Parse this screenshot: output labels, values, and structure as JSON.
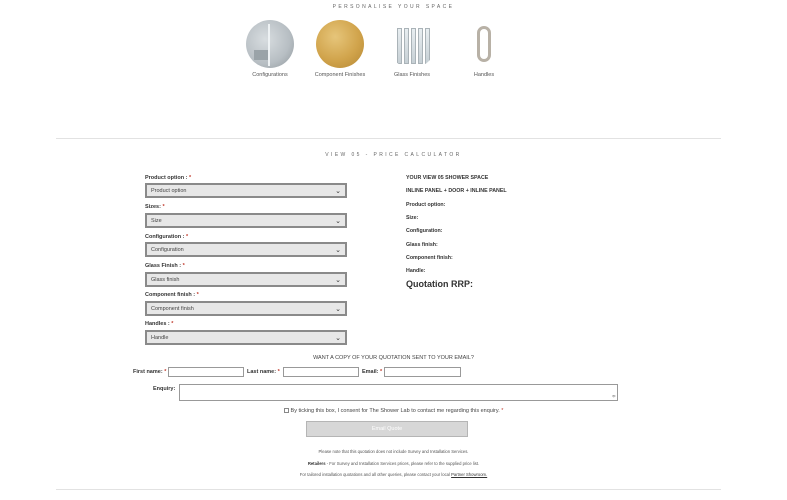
{
  "personalise": {
    "title": "PERSONALISE YOUR SPACE",
    "options": [
      {
        "label": "Configurations"
      },
      {
        "label": "Component Finishes"
      },
      {
        "label": "Glass Finishes"
      },
      {
        "label": "Handles"
      }
    ]
  },
  "calculator": {
    "title": "VIEW 05 - PRICE CALCULATOR",
    "fields": [
      {
        "label": "Product option :",
        "required": "*",
        "selected": "Product option"
      },
      {
        "label": "Sizes:",
        "required": "*",
        "selected": "Size"
      },
      {
        "label": "Configuration :",
        "required": "*",
        "selected": "Configuration"
      },
      {
        "label": "Glass Finish :",
        "required": "*",
        "selected": "Glass finish"
      },
      {
        "label": "Component finish :",
        "required": "*",
        "selected": "Component finish"
      },
      {
        "label": "Handles :",
        "required": "*",
        "selected": "Handle"
      }
    ],
    "summary": {
      "heading": "YOUR VIEW 05 SHOWER SPACE",
      "subheading": "INLINE PANEL + DOOR + INLINE PANEL",
      "rows": [
        "Product option:",
        "Size:",
        "Configuration:",
        "Glass finish:",
        "Component finish:",
        "Handle:"
      ],
      "quotation": "Quotation RRP:"
    }
  },
  "quote_form": {
    "question": "WANT A COPY OF YOUR QUOTATION SENT TO YOUR EMAIL?",
    "first_name_label": "First name:",
    "last_name_label": "Last name:",
    "email_label": "Email:",
    "required": "*",
    "enquiry_label": "Enquiry:",
    "consent": "By ticking this box, I consent for The Shower Lab to contact me regarding this enquiry.",
    "consent_required": "*",
    "button": "Email Quote"
  },
  "notes": {
    "line1": "Please note that this quotation does not include Survey and Installation Services.",
    "line2_bold": "Retailers",
    "line2_rest": " - For Survey and Installation Services prices, please refer to the supplied price list.",
    "line3": "For tailored installation quotations and all other queries, please contact your local ",
    "line3_link": "Partner Showroom."
  },
  "colors": {
    "required": "#c0392b",
    "gold": "#d1a44c",
    "button": "#d7d7d7"
  }
}
